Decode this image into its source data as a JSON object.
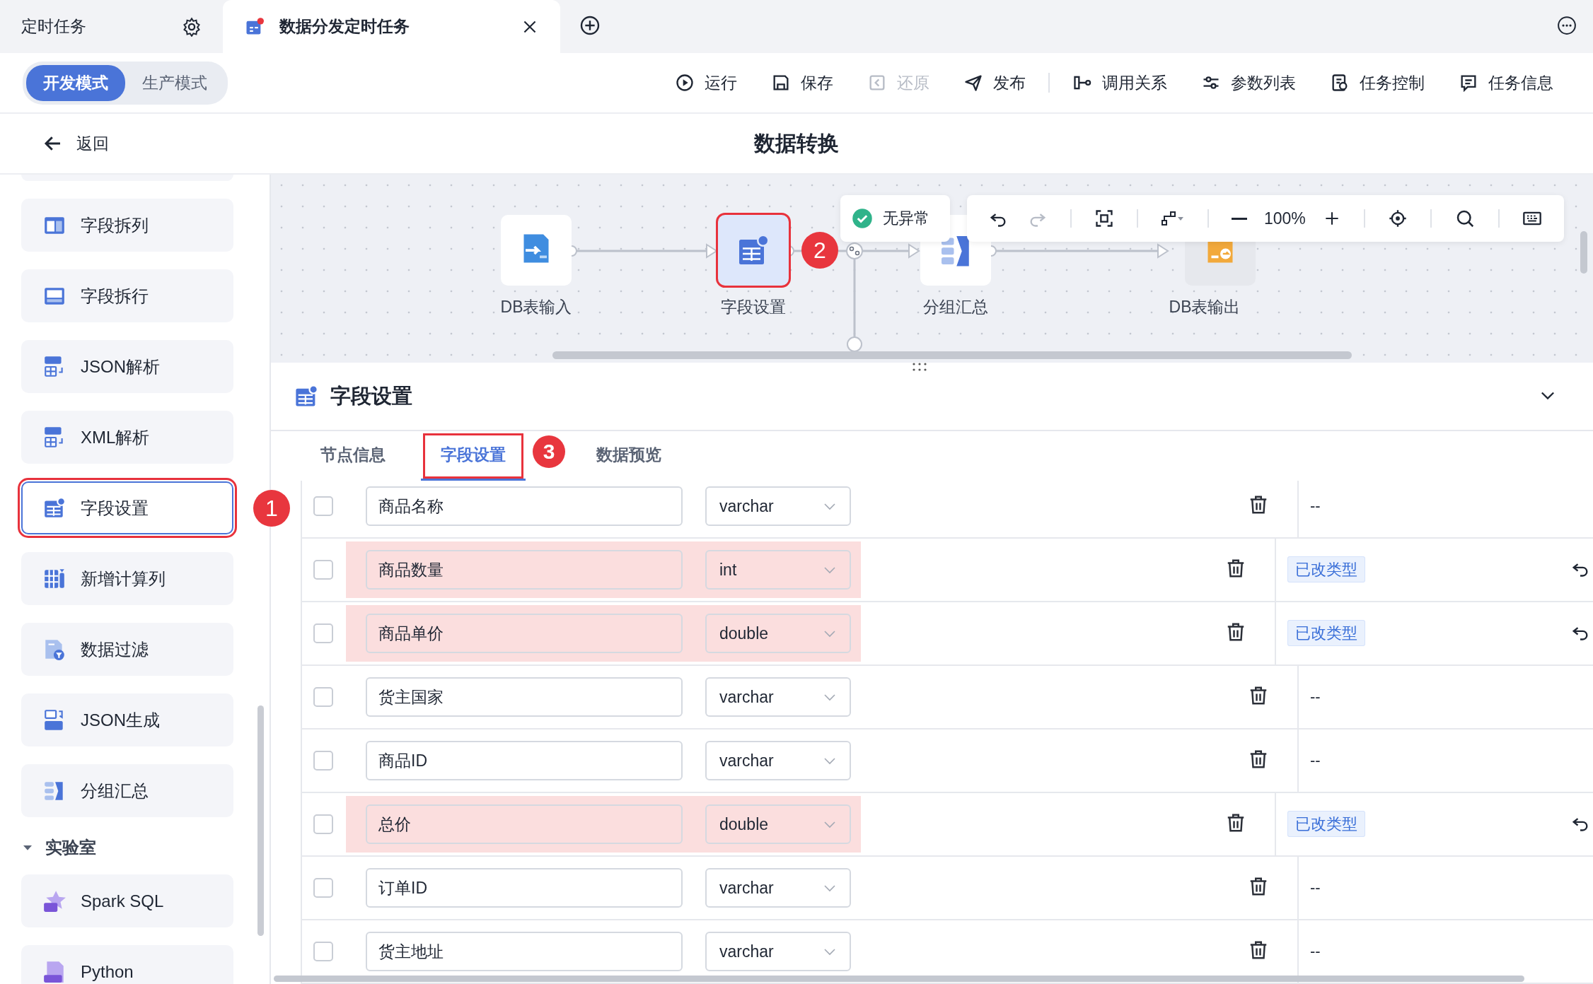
{
  "tabs": [
    {
      "label": "定时任务",
      "selected": false
    },
    {
      "label": "数据分发定时任务",
      "selected": true
    }
  ],
  "modes": [
    {
      "label": "开发模式",
      "selected": true
    },
    {
      "label": "生产模式",
      "selected": false
    }
  ],
  "action_groups": [
    [
      {
        "label": "运行",
        "disabled": false
      },
      {
        "label": "保存",
        "disabled": false
      },
      {
        "label": "还原",
        "disabled": true
      },
      {
        "label": "发布",
        "disabled": false
      }
    ],
    [
      {
        "label": "调用关系",
        "disabled": false
      },
      {
        "label": "参数列表",
        "disabled": false
      },
      {
        "label": "任务控制",
        "disabled": false
      },
      {
        "label": "任务信息",
        "disabled": false
      }
    ]
  ],
  "back": "返回",
  "title": "数据转换",
  "sidebar": {
    "items": [
      {
        "label": "字段拆列",
        "selected": false
      },
      {
        "label": "字段拆行",
        "selected": false
      },
      {
        "label": "JSON解析",
        "selected": false
      },
      {
        "label": "XML解析",
        "selected": false
      },
      {
        "label": "字段设置",
        "selected": true,
        "callout": "1"
      },
      {
        "label": "新增计算列",
        "selected": false
      },
      {
        "label": "数据过滤",
        "selected": false
      },
      {
        "label": "JSON生成",
        "selected": false
      },
      {
        "label": "分组汇总",
        "selected": false
      }
    ],
    "section": {
      "label": "实验室",
      "expanded": true,
      "items": [
        {
          "label": "Spark SQL"
        },
        {
          "label": "Python"
        }
      ]
    }
  },
  "canvas": {
    "nodes": [
      {
        "label": "DB表输入",
        "selected": false
      },
      {
        "label": "字段设置",
        "selected": true,
        "callout": "2"
      },
      {
        "label": "分组汇总",
        "selected": false
      },
      {
        "label": "DB表输出",
        "selected": false
      }
    ],
    "status": "无异常",
    "zoom": "100%"
  },
  "panel": {
    "title": "字段设置",
    "tabs": [
      {
        "label": "节点信息",
        "selected": false
      },
      {
        "label": "字段设置",
        "selected": true,
        "callout": "3"
      },
      {
        "label": "数据预览",
        "selected": false
      }
    ],
    "rows": [
      {
        "checked": false,
        "name": "商品名称",
        "type": "varchar",
        "changed": false,
        "status": "--"
      },
      {
        "checked": false,
        "name": "商品数量",
        "type": "int",
        "changed": true,
        "status": "已改类型"
      },
      {
        "checked": false,
        "name": "商品单价",
        "type": "double",
        "changed": true,
        "status": "已改类型"
      },
      {
        "checked": false,
        "name": "货主国家",
        "type": "varchar",
        "changed": false,
        "status": "--"
      },
      {
        "checked": false,
        "name": "商品ID",
        "type": "varchar",
        "changed": false,
        "status": "--"
      },
      {
        "checked": false,
        "name": "总价",
        "type": "double",
        "changed": true,
        "status": "已改类型"
      },
      {
        "checked": false,
        "name": "订单ID",
        "type": "varchar",
        "changed": false,
        "status": "--"
      },
      {
        "checked": false,
        "name": "货主地址",
        "type": "varchar",
        "changed": false,
        "status": "--"
      }
    ]
  }
}
